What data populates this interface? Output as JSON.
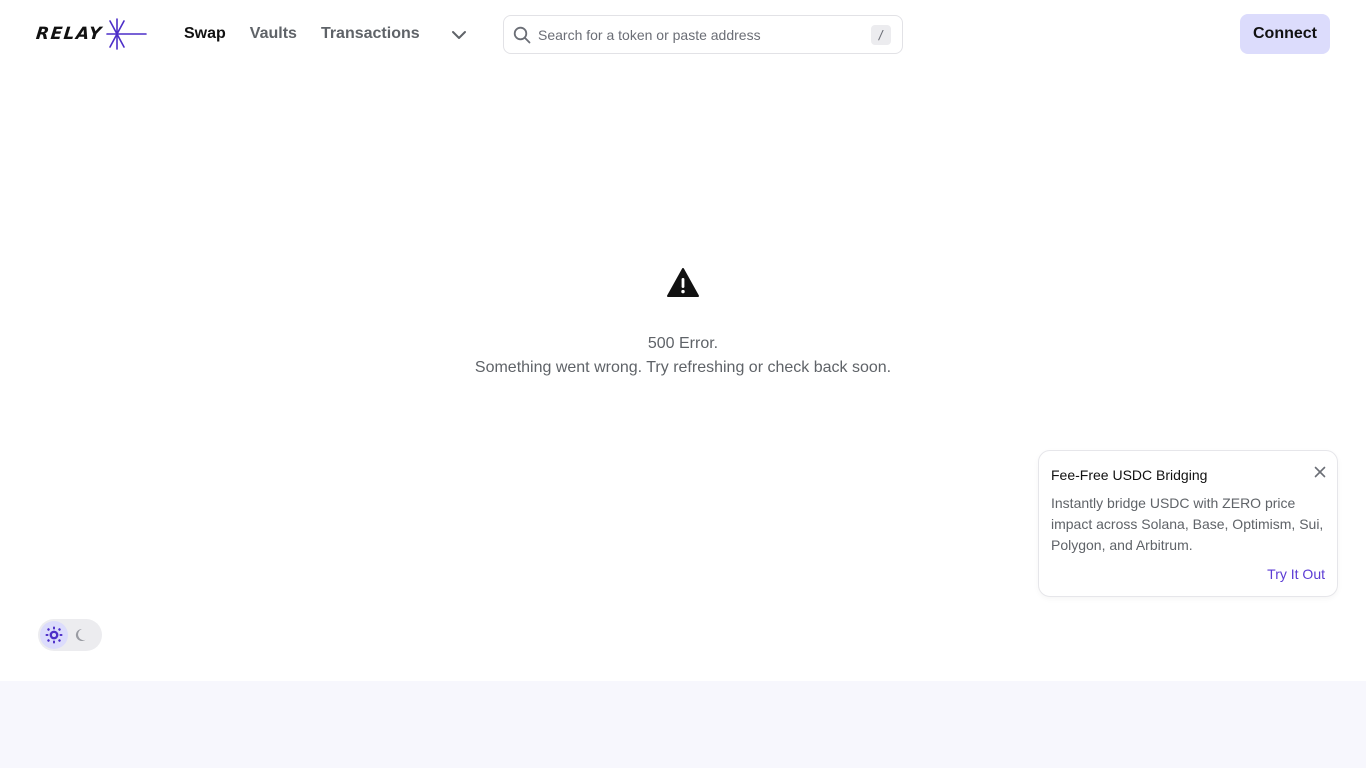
{
  "brand": {
    "name": "RELAY",
    "accent": "#4c2ec8"
  },
  "nav": {
    "items": [
      {
        "label": "Swap",
        "active": true
      },
      {
        "label": "Vaults",
        "active": false
      },
      {
        "label": "Transactions",
        "active": false
      }
    ]
  },
  "search": {
    "placeholder": "Search for a token or paste address",
    "shortcut": "/"
  },
  "header": {
    "connect_label": "Connect"
  },
  "error": {
    "title": "500 Error.",
    "message": "Something went wrong. Try refreshing or check back soon."
  },
  "toast": {
    "title": "Fee-Free USDC Bridging",
    "body": "Instantly bridge USDC with ZERO price impact across Solana, Base, Optimism, Sui, Polygon, and Arbitrum.",
    "cta": "Try It Out"
  },
  "theme": {
    "selected": "light",
    "options": [
      "sun-icon",
      "moon-icon"
    ]
  },
  "colors": {
    "connect_bg": "#dcdcfc",
    "link": "#5b3bd4",
    "footer_bg": "#f7f7fd"
  }
}
